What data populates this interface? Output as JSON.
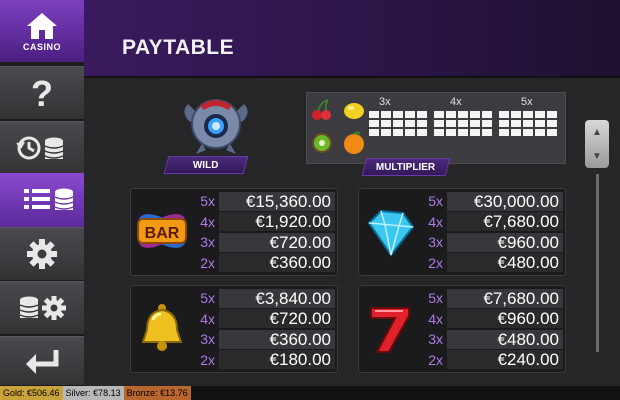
{
  "nav": {
    "casino_label": "CASINO",
    "items": [
      {
        "name": "help",
        "icon": "question-icon"
      },
      {
        "name": "history",
        "icon": "history-coins-icon"
      },
      {
        "name": "paytable",
        "icon": "paytable-list-icon",
        "active": true
      },
      {
        "name": "settings",
        "icon": "gear-icon"
      },
      {
        "name": "bet-settings",
        "icon": "coins-gear-icon"
      },
      {
        "name": "back",
        "icon": "back-arrow-icon"
      }
    ]
  },
  "header": {
    "title": "PAYTABLE"
  },
  "specials": {
    "wild_label": "WILD",
    "multiplier_label": "MULTIPLIER",
    "multiplier_columns": [
      "3x",
      "4x",
      "5x"
    ],
    "fruit_icons": [
      "cherry-icon",
      "lemon-icon",
      "kiwi-icon",
      "orange-icon"
    ]
  },
  "paytable": [
    {
      "symbol": "bar-symbol-icon",
      "rows": [
        {
          "mul": "5x",
          "amount": "€15,360.00"
        },
        {
          "mul": "4x",
          "amount": "€1,920.00"
        },
        {
          "mul": "3x",
          "amount": "€720.00"
        },
        {
          "mul": "2x",
          "amount": "€360.00"
        }
      ]
    },
    {
      "symbol": "diamond-symbol-icon",
      "rows": [
        {
          "mul": "5x",
          "amount": "€30,000.00"
        },
        {
          "mul": "4x",
          "amount": "€7,680.00"
        },
        {
          "mul": "3x",
          "amount": "€960.00"
        },
        {
          "mul": "2x",
          "amount": "€480.00"
        }
      ]
    },
    {
      "symbol": "bell-symbol-icon",
      "rows": [
        {
          "mul": "5x",
          "amount": "€3,840.00"
        },
        {
          "mul": "4x",
          "amount": "€720.00"
        },
        {
          "mul": "3x",
          "amount": "€360.00"
        },
        {
          "mul": "2x",
          "amount": "€180.00"
        }
      ]
    },
    {
      "symbol": "seven-symbol-icon",
      "rows": [
        {
          "mul": "5x",
          "amount": "€7,680.00"
        },
        {
          "mul": "4x",
          "amount": "€960.00"
        },
        {
          "mul": "3x",
          "amount": "€480.00"
        },
        {
          "mul": "2x",
          "amount": "€240.00"
        }
      ]
    }
  ],
  "footer": {
    "gold": "Gold: €506.46",
    "silver": "Silver: €78.13",
    "bronze": "Bronze: €13.76"
  },
  "colors": {
    "accent": "#7d3fbf",
    "multiplier_text": "#b07ae8",
    "gold": "#c9a23a",
    "silver": "#b8b8b8",
    "bronze": "#b8652e"
  }
}
